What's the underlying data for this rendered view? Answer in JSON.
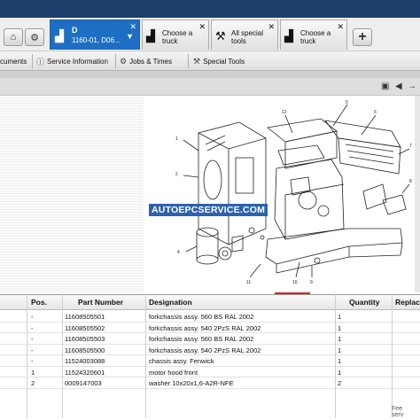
{
  "colors": {
    "topbar": "#1b3e6b",
    "active_tab": "#1e6fc3",
    "watermark_bg": "#2d62b0",
    "accent_red": "#dd2222"
  },
  "tabs": [
    {
      "title": "D",
      "subtitle": "1160-01, D06...",
      "active": true,
      "icon": "forklift-icon"
    },
    {
      "label": "Choose a truck",
      "icon": "forklift-icon"
    },
    {
      "label": "All special tools",
      "icon": "wrench-icon"
    },
    {
      "label": "Choose a truck",
      "icon": "forklift-icon"
    }
  ],
  "toolbar": {
    "documents": "cuments",
    "service_information": "Service Information",
    "jobs_times": "Jobs & Times",
    "special_tools": "Special Tools"
  },
  "watermark": "AUTOEPCSERVICE.COM",
  "table": {
    "headers": [
      "Pos.",
      "Part Number",
      "Designation",
      "Quantity",
      "Replac"
    ],
    "rows": [
      {
        "pos": "-",
        "part": "11608505501",
        "designation": "forkchassis assy. 560 BS RAL 2002",
        "qty": "1"
      },
      {
        "pos": "-",
        "part": "11608505502",
        "designation": "forkchassis assy. 540 2PzS RAL 2002",
        "qty": "1"
      },
      {
        "pos": "-",
        "part": "11608505503",
        "designation": "forkchassis assy. 560 BS RAL 2002",
        "qty": "1"
      },
      {
        "pos": "-",
        "part": "11608505500",
        "designation": "forkchassis assy. 540 2PzS RAL 2002",
        "qty": "1"
      },
      {
        "pos": "-",
        "part": "11524003088",
        "designation": "chassis assy. Fenwick",
        "qty": "1"
      },
      {
        "pos": "1",
        "part": "11524320601",
        "designation": "motor hood front",
        "qty": "1"
      },
      {
        "pos": "2",
        "part": "0009147003",
        "designation": "washer 10x20x1,6-A2R-NFE",
        "qty": "2"
      }
    ]
  },
  "footer": {
    "line1": "Fee",
    "line2": "serv"
  }
}
